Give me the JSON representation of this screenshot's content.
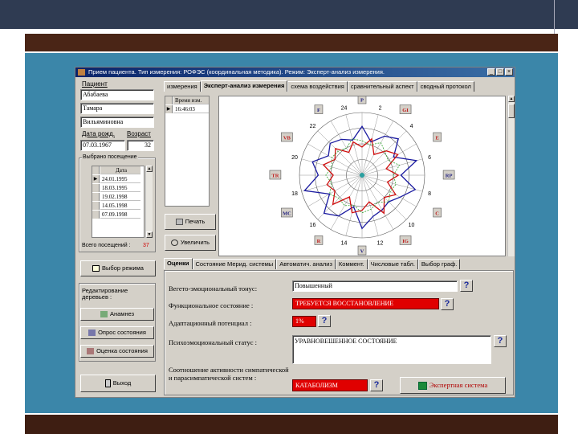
{
  "window": {
    "title": "Прием пациента. Тип измерения: РОФЭС (координальная методика). Режим: Эксперт-анализ измерения.",
    "controls": [
      "_",
      "□",
      "×"
    ]
  },
  "patient": {
    "section_label": "Пациент",
    "last_name": "Абабаева",
    "first_name": "Тамара",
    "patronymic": "Вильяминовна",
    "dob_label": "Дата рожд.",
    "dob": "07.03.1967",
    "age_label": "Возраст",
    "age": "32"
  },
  "visits": {
    "group_label": "Выбрано посещение",
    "column_header": "Дата",
    "rows": [
      "24.01.1995",
      "18.03.1995",
      "19.02.1998",
      "14.05.1998",
      "07.09.1998"
    ],
    "total_label": "Всего посещений :",
    "total_value": "37"
  },
  "left_buttons": {
    "mode": "Выбор режима",
    "edit_tree_label": "Редактирование деревьев :",
    "anamnesis": "Анамнез",
    "survey": "Опрос состояния",
    "assessment": "Оценка состояния",
    "exit": "Выход"
  },
  "top_tabs": [
    "измерения",
    "Эксперт-анализ измерения",
    "схема воздействия",
    "сравнительный аспект",
    "сводный протокол"
  ],
  "measure_time": {
    "header": "Время изм.",
    "value": "16:46:03"
  },
  "side_actions": {
    "print": "Печать",
    "zoom": "Увеличить"
  },
  "chart_data": {
    "type": "radar",
    "hour_labels": [
      "2",
      "4",
      "6",
      "8",
      "10",
      "12",
      "14",
      "16",
      "18",
      "20",
      "22",
      "24"
    ],
    "meridian_labels": [
      "P",
      "GI",
      "E",
      "RP",
      "C",
      "IG",
      "V",
      "R",
      "MC",
      "TR",
      "VB",
      "F"
    ],
    "series": [
      {
        "name": "",
        "color": "#1a1aa0",
        "values": [
          0.78,
          0.55,
          0.72,
          0.82,
          0.58,
          0.9,
          0.62,
          0.88,
          0.7,
          0.6,
          0.64,
          0.68,
          0.85,
          0.52,
          0.75,
          0.86,
          0.6,
          0.95,
          0.7,
          0.82,
          0.62,
          0.72,
          0.66,
          0.58
        ]
      },
      {
        "name": "",
        "color": "#d01010",
        "values": [
          0.45,
          0.6,
          0.38,
          0.55,
          0.66,
          0.4,
          0.58,
          0.42,
          0.62,
          0.5,
          0.7,
          0.44,
          0.56,
          0.62,
          0.4,
          0.66,
          0.5,
          0.58,
          0.46,
          0.64,
          0.5,
          0.6,
          0.42,
          0.55
        ]
      },
      {
        "name": "",
        "color": "#2aa02a",
        "values": [
          0.55,
          0.5,
          0.6,
          0.52,
          0.48,
          0.62,
          0.5,
          0.56,
          0.52,
          0.6,
          0.5,
          0.56,
          0.6,
          0.5,
          0.56,
          0.52,
          0.6,
          0.5,
          0.58,
          0.5,
          0.56,
          0.54,
          0.5,
          0.6
        ]
      }
    ],
    "grid": true
  },
  "bottom_tabs": [
    "Оценки",
    "Состояние Мерид. системы",
    "Автоматич. анализ",
    "Коммент.",
    "Числовые табл.",
    "Выбор граф."
  ],
  "assessments": {
    "vegetative_label": "Вегето-эмоциональный тонус:",
    "vegetative_value": "Повышенный",
    "functional_label": "Функциональное состояние :",
    "functional_value": "ТРЕБУЕТСЯ ВОССТАНОВЛЕНИЕ",
    "adaptive_label": "Адаптационный потенциал :",
    "adaptive_value": "1%",
    "psycho_label": "Психоэмоциональный статус :",
    "psycho_value": "УРАВНОВЕШЕННОЕ СОСТОЯНИЕ",
    "ratio_label": "Соотношение активности симпатической и парасимпатической систем :",
    "ratio_value": "КАТАБОЛИЗМ",
    "expert_button": "Экспертная система",
    "help_glyph": "?"
  },
  "colors": {
    "title_bar": "#0a246a",
    "slide_panel": "#3b86a9",
    "slide_bar": "#4a2516",
    "alert_red": "#e00000"
  }
}
